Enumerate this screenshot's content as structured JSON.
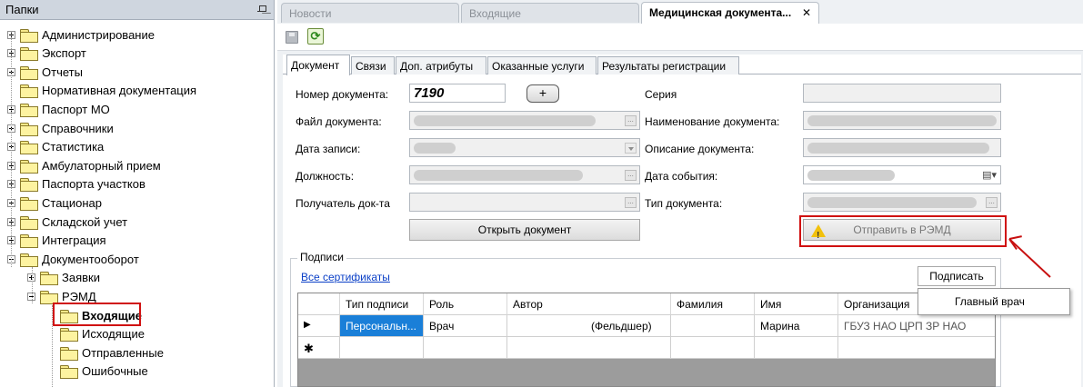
{
  "left_panel": {
    "title": "Папки",
    "items": [
      {
        "label": "Администрирование",
        "expander": "plus",
        "level": 0
      },
      {
        "label": "Экспорт",
        "expander": "plus",
        "level": 0
      },
      {
        "label": "Отчеты",
        "expander": "plus",
        "level": 0
      },
      {
        "label": "Нормативная документация",
        "expander": "none",
        "level": 0
      },
      {
        "label": "Паспорт МО",
        "expander": "plus",
        "level": 0
      },
      {
        "label": "Справочники",
        "expander": "plus",
        "level": 0
      },
      {
        "label": "Статистика",
        "expander": "plus",
        "level": 0
      },
      {
        "label": "Амбулаторный прием",
        "expander": "plus",
        "level": 0
      },
      {
        "label": "Паспорта участков",
        "expander": "plus",
        "level": 0
      },
      {
        "label": "Стационар",
        "expander": "plus",
        "level": 0
      },
      {
        "label": "Складской учет",
        "expander": "plus",
        "level": 0
      },
      {
        "label": "Интеграция",
        "expander": "plus",
        "level": 0
      },
      {
        "label": "Документооборот",
        "expander": "minus",
        "level": 0
      },
      {
        "label": "Заявки",
        "expander": "plus",
        "level": 1
      },
      {
        "label": "РЭМД",
        "expander": "minus",
        "level": 1
      },
      {
        "label": "Входящие",
        "expander": "none",
        "level": 2,
        "selected": true
      },
      {
        "label": "Исходящие",
        "expander": "none",
        "level": 2
      },
      {
        "label": "Отправленные",
        "expander": "none",
        "level": 2
      },
      {
        "label": "Ошибочные",
        "expander": "none",
        "level": 2
      }
    ]
  },
  "doc_tabs": [
    {
      "label": "Новости",
      "active": false
    },
    {
      "label": "Входящие",
      "active": false
    },
    {
      "label": "Медицинская документа...",
      "active": true,
      "close": "✕"
    }
  ],
  "form_tabs": [
    "Документ",
    "Связи",
    "Доп. атрибуты",
    "Оказанные услуги",
    "Результаты регистрации"
  ],
  "form": {
    "doc_number_label": "Номер документа:",
    "doc_number_value": "7190",
    "plus_label": "+",
    "file_label": "Файл документа:",
    "record_date_label": "Дата записи:",
    "position_label": "Должность:",
    "recipient_label": "Получатель док-та",
    "open_button": "Открыть документ",
    "series_label": "Серия",
    "doc_name_label": "Наименование документа:",
    "doc_desc_label": "Описание документа:",
    "event_date_label": "Дата события:",
    "doc_type_label": "Тип документа:",
    "send_button": "Отправить в РЭМД",
    "ellipsis": "..."
  },
  "signatures": {
    "group_title": "Подписи",
    "all_certs_link": "Все сертификаты",
    "sign_button": "Подписать",
    "columns": [
      "Тип подписи",
      "Роль",
      "Автор",
      "Фамилия",
      "Имя",
      "Организация"
    ],
    "rows": [
      {
        "indicator": "▶",
        "type": "Персональн...",
        "role": "Врач",
        "author": "(Фельдшер)",
        "surname": "",
        "name": "Марина",
        "org": "ГБУЗ НАО ЦРП ЗР НАО"
      }
    ],
    "new_row_indicator": "✱"
  },
  "context_menu": {
    "items": [
      "Главный врач"
    ]
  },
  "colors": {
    "annotation_red": "#d01010",
    "selection_blue": "#1a7fd8",
    "link_blue": "#0a3fc7",
    "warning_yellow": "#f2c10c"
  }
}
